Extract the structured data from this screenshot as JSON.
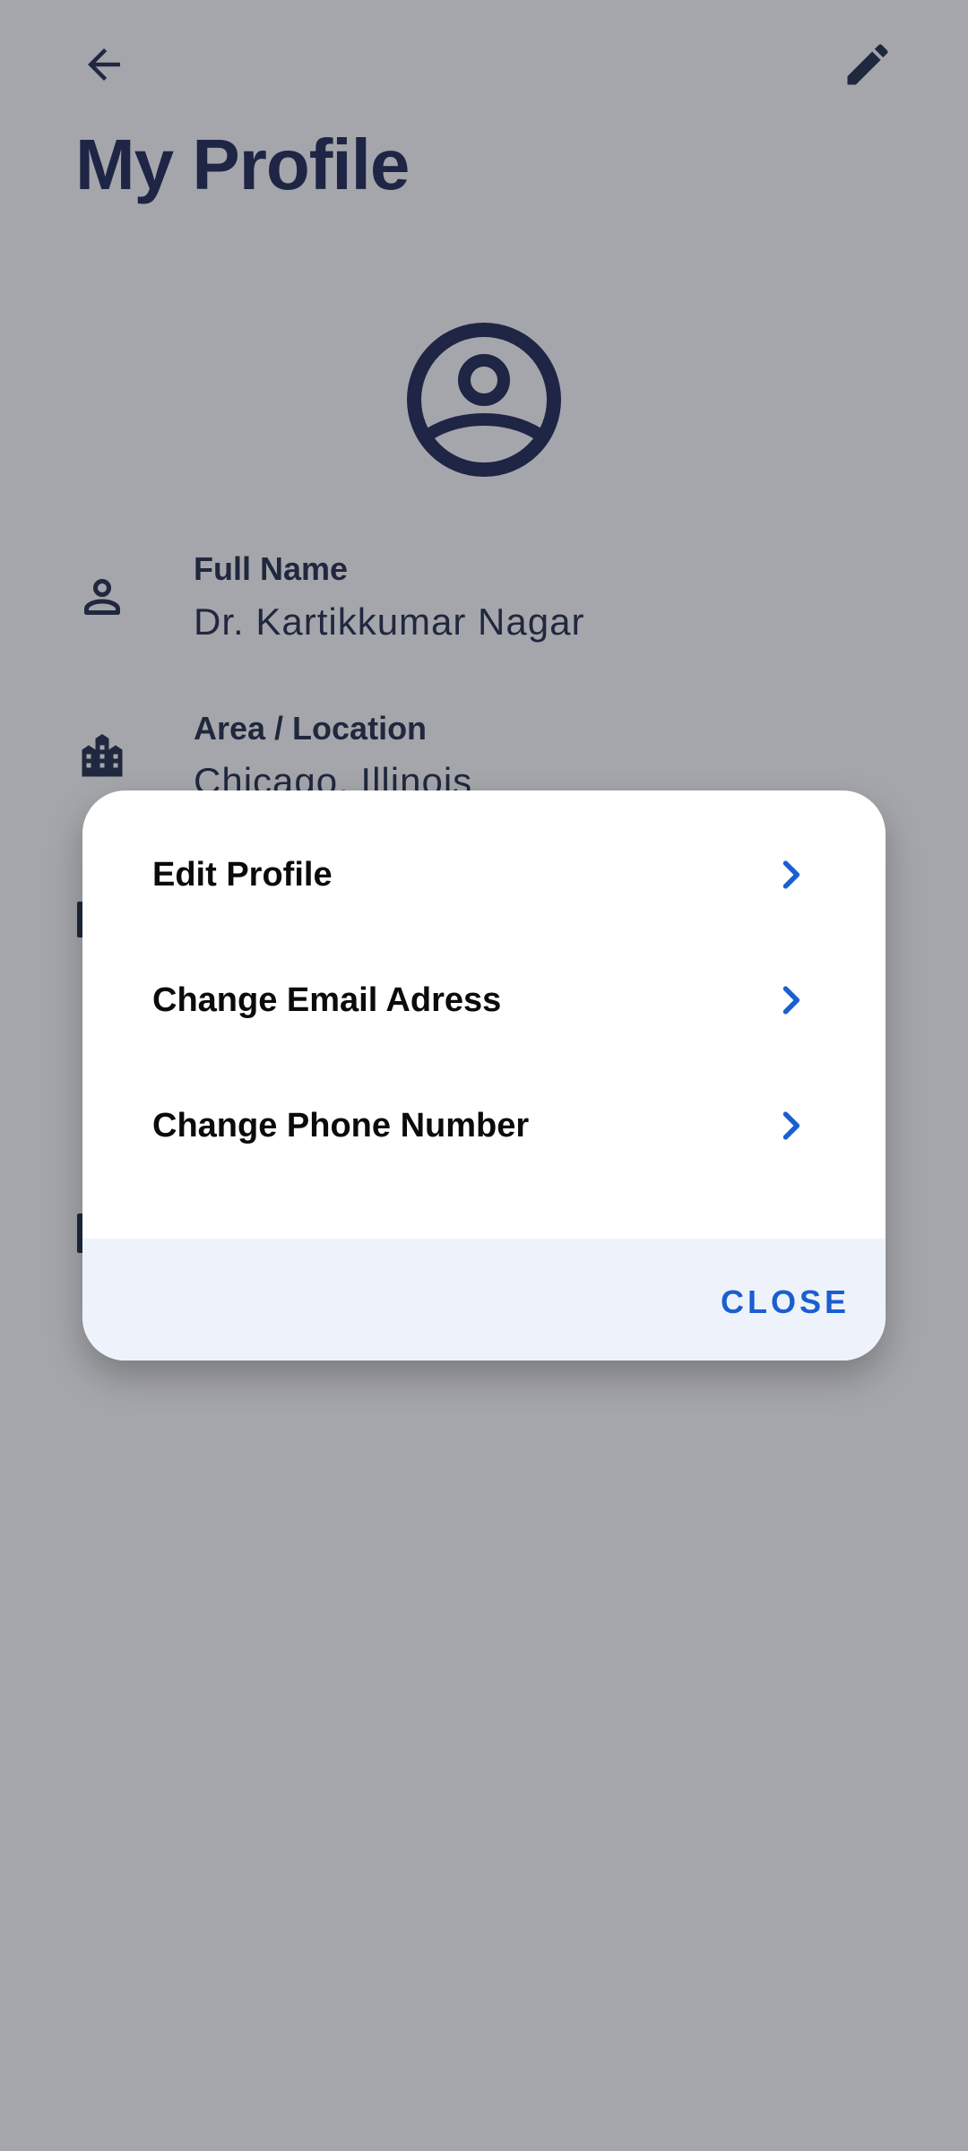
{
  "header": {
    "title": "My Profile",
    "back_icon": "arrow-left-icon",
    "edit_icon": "pencil-icon"
  },
  "profile": {
    "avatar_icon": "account-circle-icon",
    "fields": [
      {
        "icon": "person-icon",
        "label": "Full Name",
        "value": "Dr. Kartikkumar Nagar"
      },
      {
        "icon": "city-icon",
        "label": "Area / Location",
        "value": "Chicago, Illinois"
      }
    ]
  },
  "dialog": {
    "items": [
      {
        "label": "Edit Profile",
        "icon": "chevron-right-icon"
      },
      {
        "label": "Change Email Adress",
        "icon": "chevron-right-icon"
      },
      {
        "label": "Change Phone Number",
        "icon": "chevron-right-icon"
      }
    ],
    "close_label": "CLOSE"
  },
  "colors": {
    "title": "#0a1446",
    "accent": "#1a5fd0",
    "scrim": "rgba(55,58,68,0.45)",
    "footer_bg": "#eef3fb"
  }
}
